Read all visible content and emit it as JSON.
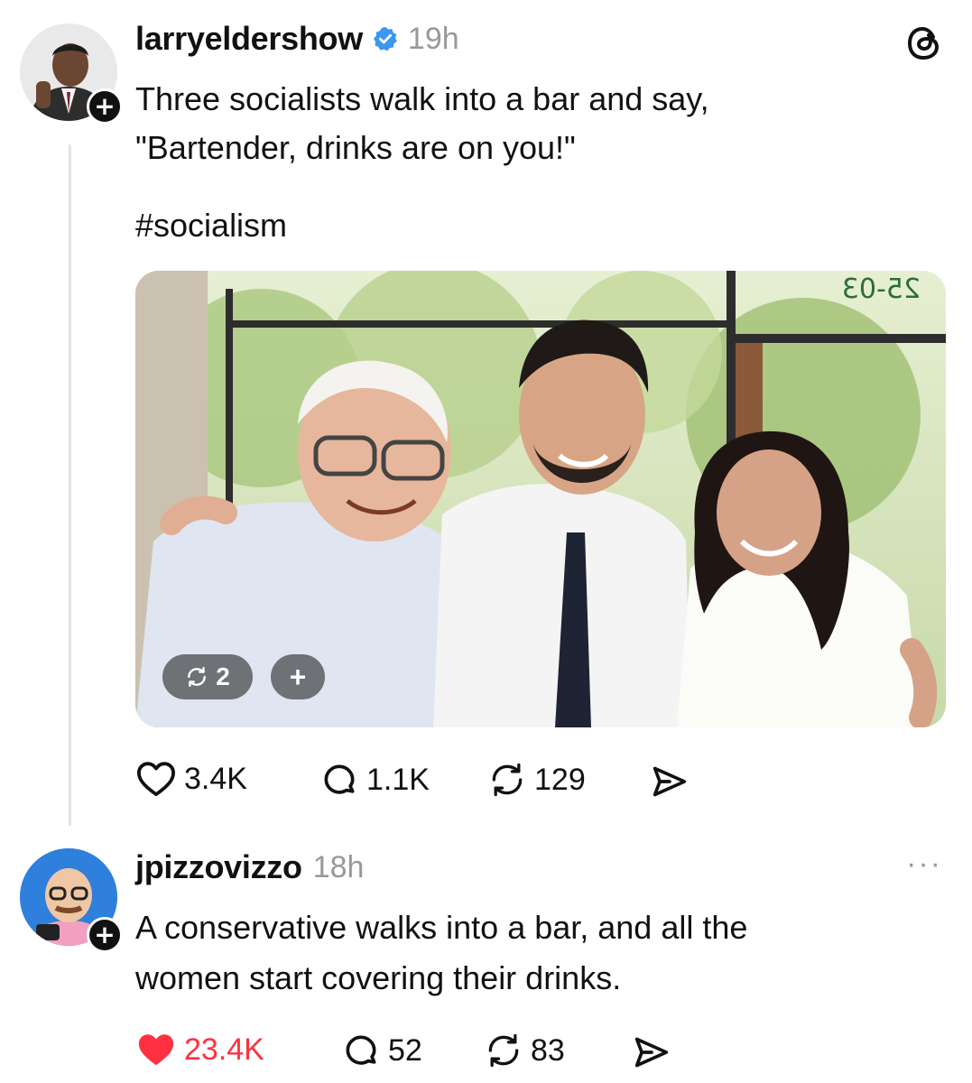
{
  "post": {
    "username": "larryeldershow",
    "time": "19h",
    "text_line1": "Three socialists walk into a bar and say,",
    "text_line2": "\"Bartender, drinks are on you!\"",
    "hashtag": "#socialism",
    "image_overlay": {
      "repost_count": "2",
      "add_label": "+",
      "sign_text": "25-03"
    },
    "stats": {
      "likes": "3.4K",
      "replies": "1.1K",
      "reposts": "129"
    }
  },
  "reply": {
    "username": "jpizzovizzo",
    "time": "18h",
    "text_line1": "A conservative walks into a bar, and all the",
    "text_line2": "women start covering their drinks.",
    "stats": {
      "likes": "23.4K",
      "replies": "52",
      "reposts": "83"
    },
    "more_label": "···"
  },
  "app": {
    "logo": "threads-logo-icon"
  },
  "colors": {
    "verified": "#3b97f0",
    "liked": "#ff3040",
    "muted": "#999999"
  }
}
